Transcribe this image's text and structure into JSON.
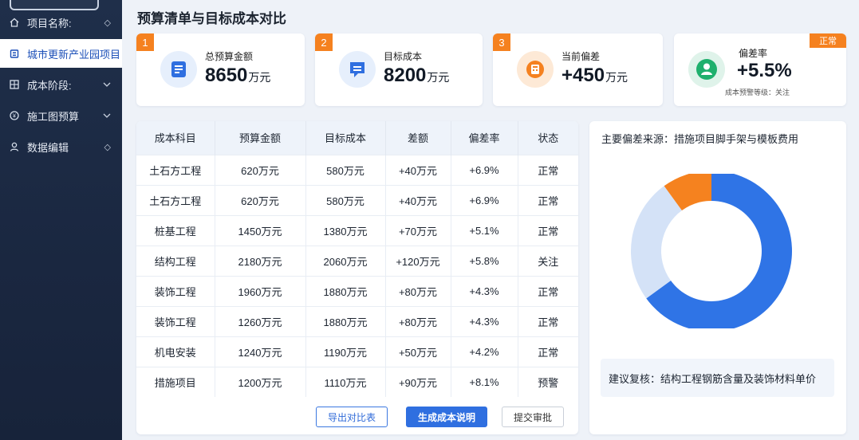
{
  "sidebar": {
    "items": [
      {
        "label": "项目名称:",
        "icon": "home-icon",
        "arrow": "◇"
      },
      {
        "label": "城市更新产业园项目",
        "icon": "building-icon",
        "arrow": ""
      },
      {
        "label": "成本阶段:",
        "icon": "grid-icon",
        "arrow": "⌄"
      },
      {
        "label": "施工图预算",
        "icon": "coin-icon",
        "arrow": "⌄"
      },
      {
        "label": "数据编辑",
        "icon": "user-icon",
        "arrow": "◇"
      }
    ]
  },
  "page_title": "预算清单与目标成本对比",
  "kpis": [
    {
      "num": "1",
      "label": "总预算金额",
      "value": "8650",
      "unit": "万元",
      "icon": "document-icon",
      "icon_color": "#2f6fe0"
    },
    {
      "num": "2",
      "label": "目标成本",
      "value": "8200",
      "unit": "万元",
      "icon": "message-icon",
      "icon_color": "#2f6fe0"
    },
    {
      "num": "3",
      "label": "当前偏差",
      "value": "+450",
      "unit": "万元",
      "icon": "calculator-icon",
      "icon_color": "#f5811f"
    },
    {
      "label": "偏差率",
      "value": "+5.5%",
      "sub": "成本预警等级：关注",
      "tag": "正常",
      "icon": "person-icon",
      "icon_color": "#1fb06d"
    }
  ],
  "table": {
    "headers": [
      "成本科目",
      "预算金额",
      "目标成本",
      "差额",
      "偏差率",
      "状态"
    ],
    "rows": [
      [
        "土石方工程",
        "620万元",
        "580万元",
        "+40万元",
        "+6.9%",
        "正常"
      ],
      [
        "土石方工程",
        "620万元",
        "580万元",
        "+40万元",
        "+6.9%",
        "正常"
      ],
      [
        "桩基工程",
        "1450万元",
        "1380万元",
        "+70万元",
        "+5.1%",
        "正常"
      ],
      [
        "结构工程",
        "2180万元",
        "2060万元",
        "+120万元",
        "+5.8%",
        "关注"
      ],
      [
        "装饰工程",
        "1960万元",
        "1880万元",
        "+80万元",
        "+4.3%",
        "正常"
      ],
      [
        "装饰工程",
        "1260万元",
        "1880万元",
        "+80万元",
        "+4.3%",
        "正常"
      ],
      [
        "机电安装",
        "1240万元",
        "1190万元",
        "+50万元",
        "+4.2%",
        "正常"
      ],
      [
        "措施项目",
        "1200万元",
        "1110万元",
        "+90万元",
        "+8.1%",
        "预警"
      ]
    ]
  },
  "buttons": {
    "export": "导出对比表",
    "generate": "生成成本说明",
    "submit": "提交审批"
  },
  "panel": {
    "title": "主要偏差来源：措施项目脚手架与模板费用",
    "advice": "建议复核：结构工程钢筋含量及装饰材料单价"
  },
  "chart_data": {
    "type": "pie",
    "title": "",
    "slices": [
      {
        "value": 0.65,
        "color": "#2f74e6"
      },
      {
        "value": 0.25,
        "color": "#d4e2f7"
      },
      {
        "value": 0.1,
        "color": "#f5821f"
      }
    ]
  }
}
